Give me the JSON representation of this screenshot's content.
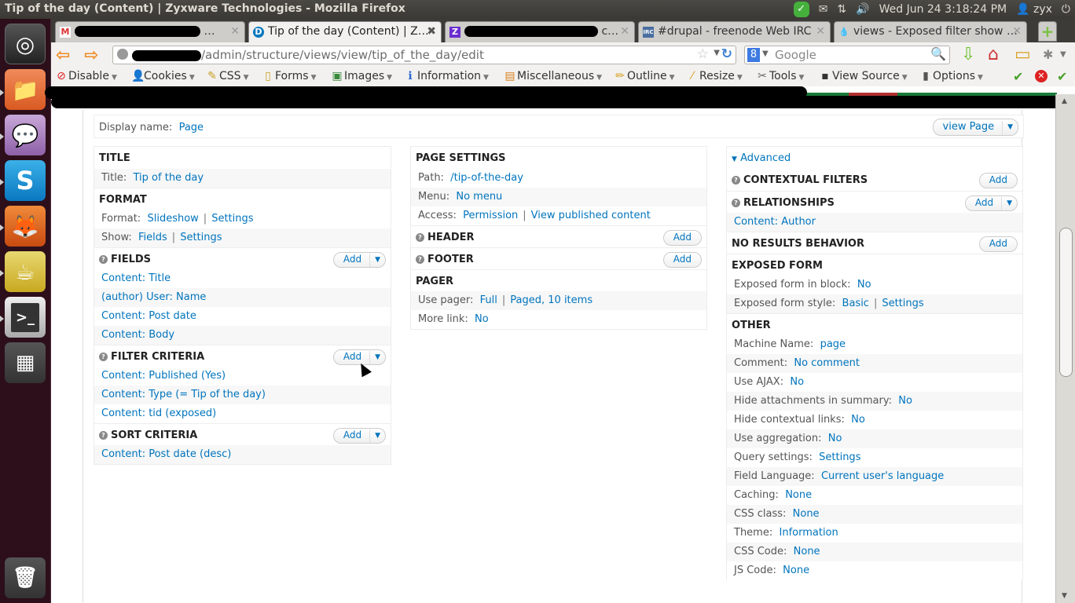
{
  "desktop": {
    "window_title": "Tip of the day (Content) | Zyxware Technologies - Mozilla Firefox",
    "tray": {
      "clock": "Wed Jun 24  3:18:24 PM",
      "user": "zyx"
    },
    "launcher": [
      {
        "name": "ubuntu-home",
        "glyph": "◎"
      },
      {
        "name": "files",
        "glyph": "📁"
      },
      {
        "name": "pidgin",
        "glyph": "💬"
      },
      {
        "name": "skype",
        "glyph": "S"
      },
      {
        "name": "firefox",
        "glyph": "🦊"
      },
      {
        "name": "teapot",
        "glyph": "☕"
      },
      {
        "name": "terminal",
        "glyph": ">_"
      },
      {
        "name": "workspaces",
        "glyph": "▦"
      },
      {
        "name": "trash",
        "glyph": "🗑"
      }
    ]
  },
  "browser": {
    "tabs": [
      {
        "label": "…",
        "icon": "M",
        "active": false
      },
      {
        "label": "Tip of the day (Content) | Z…",
        "icon": "D",
        "active": true
      },
      {
        "label": "c…",
        "icon": "Z",
        "active": false
      },
      {
        "label": "#drupal - freenode Web IRC",
        "icon": "IRC",
        "active": false
      },
      {
        "label": "views - Exposed filter show …",
        "icon": "💧",
        "active": false
      }
    ],
    "url": "/admin/structure/views/view/tip_of_the_day/edit",
    "search_placeholder": "Google",
    "devbar": [
      {
        "label": "Disable",
        "icon": "⊘"
      },
      {
        "label": "Cookies",
        "icon": "👤"
      },
      {
        "label": "CSS",
        "icon": "✎"
      },
      {
        "label": "Forms",
        "icon": "▯"
      },
      {
        "label": "Images",
        "icon": "▣"
      },
      {
        "label": "Information",
        "icon": "ℹ"
      },
      {
        "label": "Miscellaneous",
        "icon": "▤"
      },
      {
        "label": "Outline",
        "icon": "✏"
      },
      {
        "label": "Resize",
        "icon": "⁄"
      },
      {
        "label": "Tools",
        "icon": "✂"
      },
      {
        "label": "View Source",
        "icon": "▪"
      },
      {
        "label": "Options",
        "icon": "▮"
      }
    ]
  },
  "views_ui": {
    "display_name_label": "Display name:",
    "display_name_value": "Page",
    "view_page_button": "view Page",
    "add_label": "Add",
    "left": {
      "title_section": "TITLE",
      "title_row": {
        "label": "Title:",
        "value": "Tip of the day"
      },
      "format_section": "FORMAT",
      "format_row": {
        "label": "Format:",
        "value": "Slideshow",
        "extra": "Settings"
      },
      "show_row": {
        "label": "Show:",
        "value": "Fields",
        "extra": "Settings"
      },
      "fields_section": "FIELDS",
      "fields": [
        "Content: Title",
        "(author) User: Name",
        "Content: Post date",
        "Content: Body"
      ],
      "filter_section": "FILTER CRITERIA",
      "filters": [
        "Content: Published (Yes)",
        "Content: Type (= Tip of the day)",
        "Content: tid (exposed)"
      ],
      "sort_section": "SORT CRITERIA",
      "sorts": [
        "Content: Post date (desc)"
      ]
    },
    "middle": {
      "page_settings_section": "PAGE SETTINGS",
      "path_row": {
        "label": "Path:",
        "value": "/tip-of-the-day"
      },
      "menu_row": {
        "label": "Menu:",
        "value": "No menu"
      },
      "access_row": {
        "label": "Access:",
        "value": "Permission",
        "extra": "View published content"
      },
      "header_section": "HEADER",
      "footer_section": "FOOTER",
      "pager_section": "PAGER",
      "use_pager_row": {
        "label": "Use pager:",
        "value": "Full",
        "extra": "Paged, 10 items"
      },
      "more_link_row": {
        "label": "More link:",
        "value": "No"
      }
    },
    "right": {
      "advanced_toggle": "Advanced",
      "contextual_section": "CONTEXTUAL FILTERS",
      "relationships_section": "RELATIONSHIPS",
      "relationships": [
        "Content: Author"
      ],
      "no_results_section": "NO RESULTS BEHAVIOR",
      "exposed_form_section": "EXPOSED FORM",
      "exposed_block_row": {
        "label": "Exposed form in block:",
        "value": "No"
      },
      "exposed_style_row": {
        "label": "Exposed form style:",
        "value": "Basic",
        "extra": "Settings"
      },
      "other_section": "OTHER",
      "other_rows": [
        {
          "label": "Machine Name:",
          "value": "page"
        },
        {
          "label": "Comment:",
          "value": "No comment"
        },
        {
          "label": "Use AJAX:",
          "value": "No"
        },
        {
          "label": "Hide attachments in summary:",
          "value": "No"
        },
        {
          "label": "Hide contextual links:",
          "value": "No"
        },
        {
          "label": "Use aggregation:",
          "value": "No"
        },
        {
          "label": "Query settings:",
          "value": "Settings"
        },
        {
          "label": "Field Language:",
          "value": "Current user's language"
        },
        {
          "label": "Caching:",
          "value": "None"
        },
        {
          "label": "CSS class:",
          "value": "None"
        },
        {
          "label": "Theme:",
          "value": "Information"
        },
        {
          "label": "CSS Code:",
          "value": "None"
        },
        {
          "label": "JS Code:",
          "value": "None"
        }
      ]
    }
  }
}
